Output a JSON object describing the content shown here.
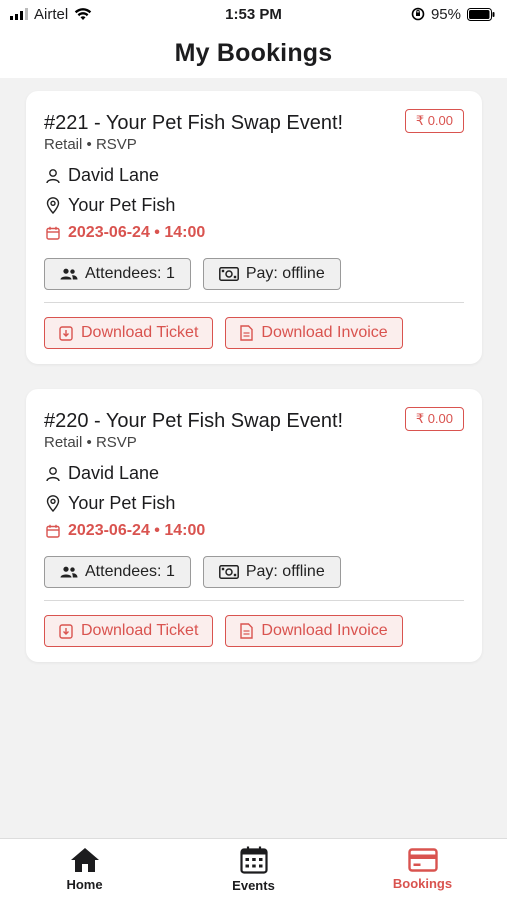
{
  "status_bar": {
    "carrier": "Airtel",
    "time": "1:53 PM",
    "battery": "95%"
  },
  "header": {
    "title": "My Bookings"
  },
  "bookings": [
    {
      "title": "#221 - Your Pet Fish Swap Event!",
      "price": "₹ 0.00",
      "category": "Retail",
      "type": "RSVP",
      "host": "David Lane",
      "venue": "Your Pet Fish",
      "date": "2023-06-24 • 14:00",
      "attendees": "Attendees: 1",
      "payment": "Pay: offline",
      "download_ticket": "Download Ticket",
      "download_invoice": "Download Invoice"
    },
    {
      "title": "#220 - Your Pet Fish Swap Event!",
      "price": "₹ 0.00",
      "category": "Retail",
      "type": "RSVP",
      "host": "David Lane",
      "venue": "Your Pet Fish",
      "date": "2023-06-24 • 14:00",
      "attendees": "Attendees: 1",
      "payment": "Pay: offline",
      "download_ticket": "Download Ticket",
      "download_invoice": "Download Invoice"
    }
  ],
  "tabs": [
    {
      "label": "Home",
      "icon": "home-icon",
      "active": false
    },
    {
      "label": "Events",
      "icon": "calendar-icon",
      "active": false
    },
    {
      "label": "Bookings",
      "icon": "card-icon",
      "active": true
    }
  ],
  "colors": {
    "accent": "#d9534f",
    "background": "#f2f2f2"
  }
}
